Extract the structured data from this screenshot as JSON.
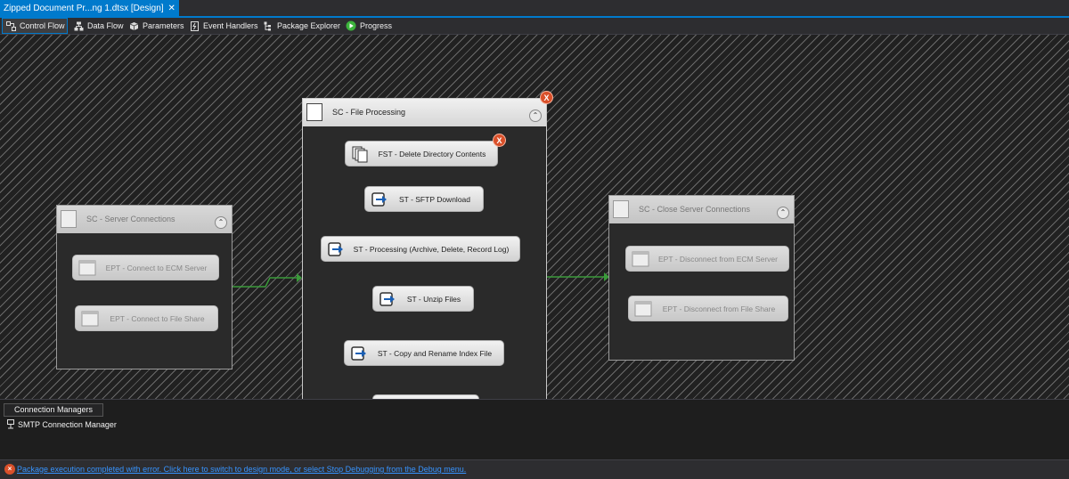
{
  "document_tab": {
    "title": "Zipped Document Pr...ng 1.dtsx [Design]",
    "close": "✕"
  },
  "toolbar": {
    "tabs": [
      {
        "label": "Control Flow",
        "icon": "control-flow-icon",
        "active": true
      },
      {
        "label": "Data Flow",
        "icon": "data-flow-icon"
      },
      {
        "label": "Parameters",
        "icon": "parameters-icon"
      },
      {
        "label": "Event Handlers",
        "icon": "event-handlers-icon"
      },
      {
        "label": "Package Explorer",
        "icon": "package-explorer-icon"
      },
      {
        "label": "Progress",
        "icon": "progress-play-icon"
      }
    ]
  },
  "canvas": {
    "containers": {
      "server_connections": {
        "title": "SC - Server Connections",
        "tasks": [
          "EPT - Connect to ECM Server",
          "EPT - Connect to File Share"
        ]
      },
      "file_processing": {
        "title": "SC - File Processing",
        "error": "X",
        "tasks": [
          "FST - Delete Directory Contents",
          "ST - SFTP Download",
          "ST - Processing (Archive, Delete, Record Log)",
          "ST - Unzip Files",
          "ST - Copy and Rename Index File"
        ]
      },
      "close_server_connections": {
        "title": "SC - Close Server Connections",
        "tasks": [
          "EPT - Disconnect from ECM Server",
          "EPT -  Disconnect from File Share"
        ]
      }
    },
    "task_error": "X",
    "collapse_glyph": "⌃"
  },
  "connection_managers": {
    "tab_label": "Connection Managers",
    "items": [
      "SMTP Connection Manager"
    ]
  },
  "status_bar": {
    "icon": "error-icon",
    "message": "Package execution completed with error. Click here to switch to design mode, or select Stop Debugging from the Debug menu."
  },
  "colors": {
    "accent": "#007acc",
    "precedence_success": "#3a9a3a",
    "error": "#d9502a",
    "link": "#3794ff"
  }
}
